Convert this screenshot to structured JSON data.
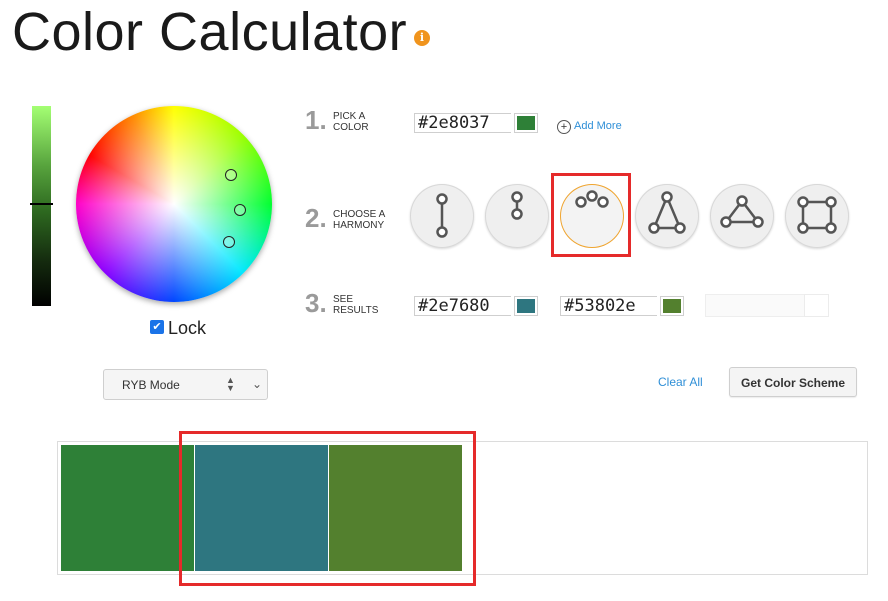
{
  "title": "Color Calculator",
  "info_icon": "info-icon",
  "lock": {
    "label": "Lock",
    "checked": true
  },
  "steps": [
    {
      "number": "1.",
      "text_line1": "PICK A",
      "text_line2": "COLOR"
    },
    {
      "number": "2.",
      "text_line1": "CHOOSE A",
      "text_line2": "HARMONY"
    },
    {
      "number": "3.",
      "text_line1": "SEE",
      "text_line2": "RESULTS"
    }
  ],
  "pick_color": {
    "hex": "#2e8037",
    "swatch": "#2e8037"
  },
  "add_more": {
    "label": "Add More",
    "icon": "plus-circle-icon"
  },
  "harmonies": [
    {
      "id": "complementary",
      "icon": "complementary-icon",
      "selected": false
    },
    {
      "id": "monochromatic",
      "icon": "monochromatic-icon",
      "selected": false
    },
    {
      "id": "analogous",
      "icon": "analogous-icon",
      "selected": true
    },
    {
      "id": "split-complementary",
      "icon": "split-complementary-icon",
      "selected": false
    },
    {
      "id": "triadic",
      "icon": "triadic-icon",
      "selected": false
    },
    {
      "id": "tetradic",
      "icon": "tetradic-icon",
      "selected": false
    }
  ],
  "results": [
    {
      "hex": "#2e7680",
      "swatch": "#2e7680"
    },
    {
      "hex": "#53802e",
      "swatch": "#53802e"
    }
  ],
  "mode_select": {
    "value": "RYB Mode"
  },
  "clear_all": "Clear All",
  "get_scheme": "Get Color Scheme",
  "palette": [
    "#2e8037",
    "#2e7680",
    "#53802e"
  ],
  "accent_colors": {
    "link": "#2f8fd7",
    "highlight": "#e52a2a",
    "selected_ring": "#f0a530"
  }
}
